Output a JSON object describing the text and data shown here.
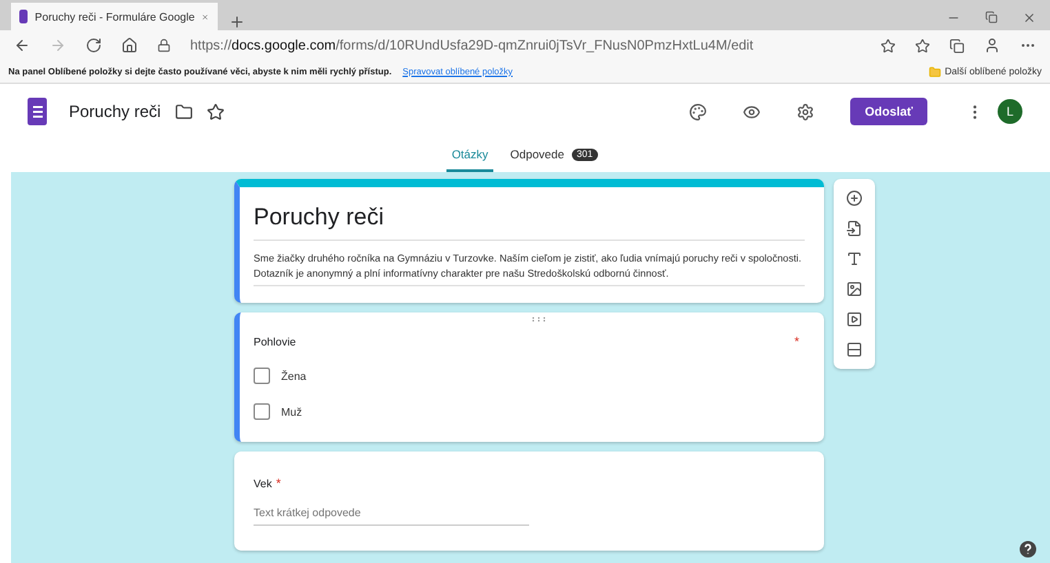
{
  "browser": {
    "tab_title": "Poruchy reči - Formuláre Google",
    "url_prefix": "https://",
    "url_host": "docs.google.com",
    "url_path": "/forms/d/10RUndUsfa29D-qmZnrui0jTsVr_FNusN0PmzHxtLu4M/edit",
    "favorites_message": "Na panel Oblíbené položky si dejte často používané věci, abyste k nim měli rychlý přístup.",
    "favorites_link": "Spravovat oblíbené položky",
    "other_favorites": "Další oblíbené položky"
  },
  "app": {
    "title": "Poruchy reči",
    "send_button": "Odoslať",
    "avatar": "L"
  },
  "tabs": [
    {
      "label": "Otázky",
      "selected": true
    },
    {
      "label": "Odpovede",
      "selected": false,
      "badge": "301"
    }
  ],
  "form": {
    "title": "Poruchy reči",
    "description": "Sme žiačky druhého ročníka na Gymnáziu v Turzovke. Naším cieľom je zistiť, ako ľudia vnímajú poruchy reči v spoločnosti. Dotazník je anonymný a plní informatívny charakter pre našu Stredoškolskú odbornú činnosť.",
    "questions": [
      {
        "kind": "checkboxes",
        "title": "Pohlovie",
        "required": true,
        "required_mark": "*",
        "active": true,
        "options": [
          {
            "label": "Žena",
            "checked": false
          },
          {
            "label": "Muž",
            "checked": false
          }
        ]
      },
      {
        "kind": "short",
        "title": "Vek",
        "required": true,
        "required_mark": "*",
        "active": false,
        "placeholder": "Text krátkej odpovede"
      }
    ]
  }
}
